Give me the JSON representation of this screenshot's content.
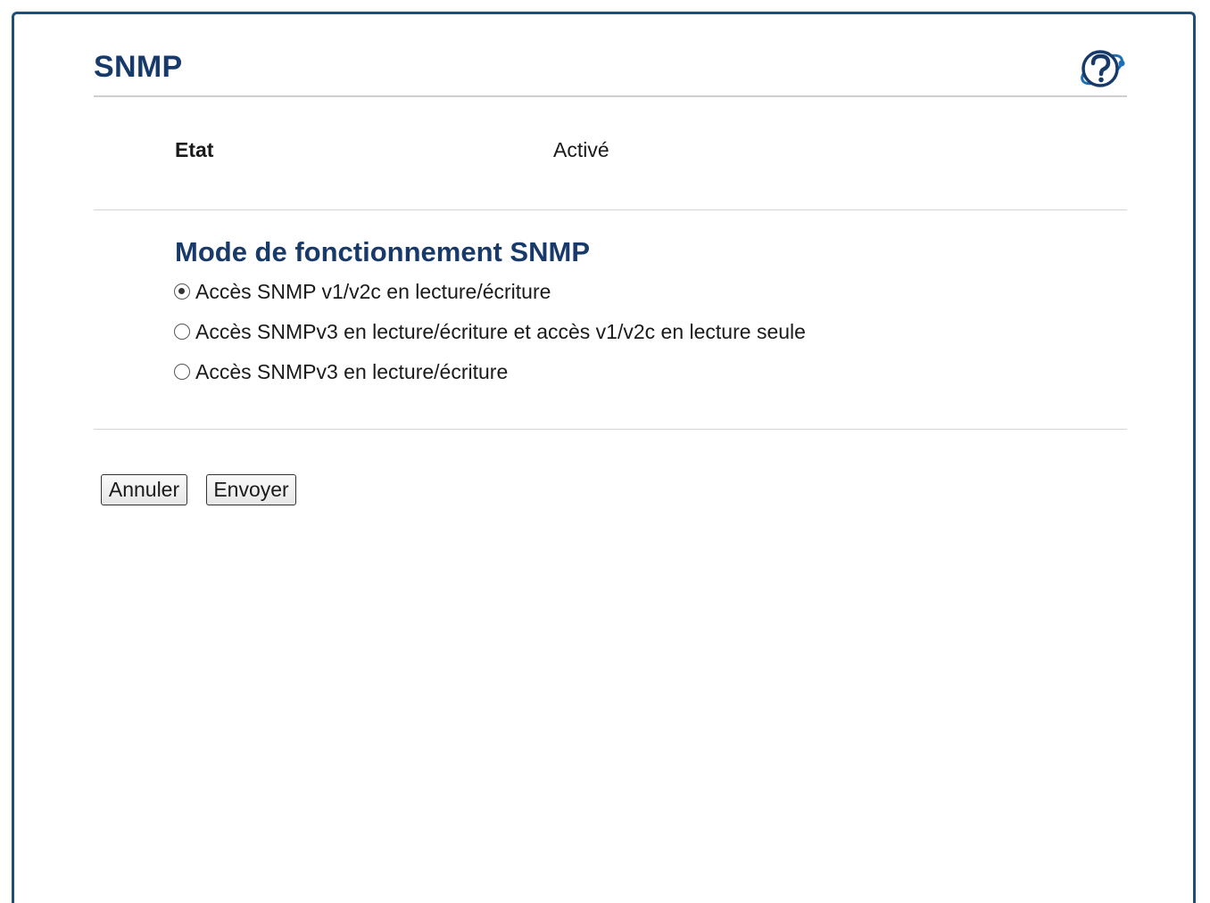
{
  "page": {
    "title": "SNMP"
  },
  "status": {
    "label": "Etat",
    "value": "Activé"
  },
  "snmp_mode": {
    "title": "Mode de fonctionnement SNMP",
    "options": [
      {
        "label": "Accès SNMP v1/v2c en lecture/écriture",
        "selected": true
      },
      {
        "label": "Accès SNMPv3 en lecture/écriture et accès v1/v2c en lecture seule",
        "selected": false
      },
      {
        "label": "Accès SNMPv3 en lecture/écriture",
        "selected": false
      }
    ]
  },
  "buttons": {
    "cancel": "Annuler",
    "submit": "Envoyer"
  },
  "icons": {
    "help": "help-icon"
  },
  "colors": {
    "frame_border": "#1f4e79",
    "heading": "#173a6b",
    "help_icon": "#1f6fb5"
  }
}
